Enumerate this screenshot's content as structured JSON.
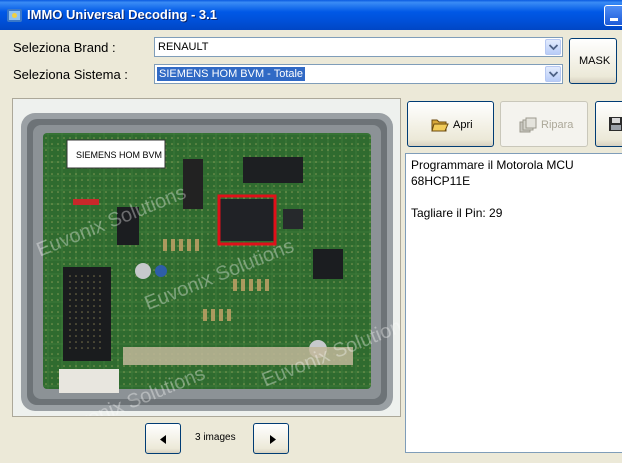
{
  "window": {
    "title": "IMMO Universal Decoding - 3.1",
    "icon": "app-icon",
    "controls": [
      "minimize-icon"
    ]
  },
  "selectors": {
    "brand_label": "Seleziona Brand :",
    "brand_value": "RENAULT",
    "system_label": "Seleziona Sistema :",
    "system_value": "SIEMENS HOM BVM - Totale"
  },
  "buttons": {
    "mask": "MASK",
    "open": "Apri",
    "repair": "Ripara",
    "save": ""
  },
  "image": {
    "caption": "SIEMENS HOM BVM",
    "watermark": "Euvonix Solutions",
    "nav_count": "3 images",
    "prev_icon": "left-arrow-icon",
    "next_icon": "right-arrow-icon"
  },
  "info": {
    "lines": [
      "Programmare il Motorola MCU",
      "68HCP11E",
      "",
      "Tagliare il Pin: 29"
    ]
  },
  "colors": {
    "title_bar": "#0058e6",
    "highlight_box": "#e0101a",
    "pcb_green": "#2f6b2f",
    "selection": "#316ac5"
  }
}
